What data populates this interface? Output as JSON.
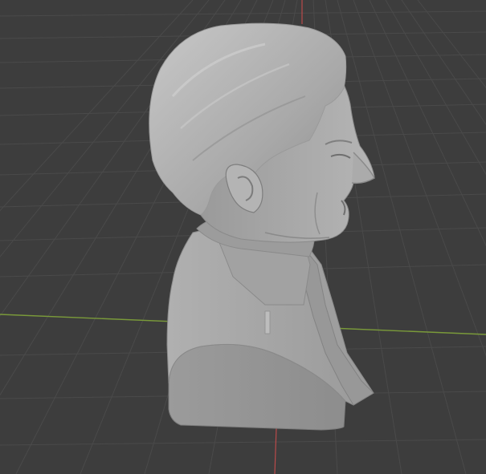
{
  "viewport": {
    "background_color": "#3d3d3d",
    "grid_line_color": "#4a4a4a",
    "x_axis_color": "#7a9a3a",
    "y_axis_color": "#b94a4a",
    "model_fill_color": "#a6a6a6",
    "model_shadow_color": "#858585",
    "model_highlight_color": "#c4c4c4",
    "model_semantic": "3d-sculpted-bust-of-man-in-suit"
  }
}
